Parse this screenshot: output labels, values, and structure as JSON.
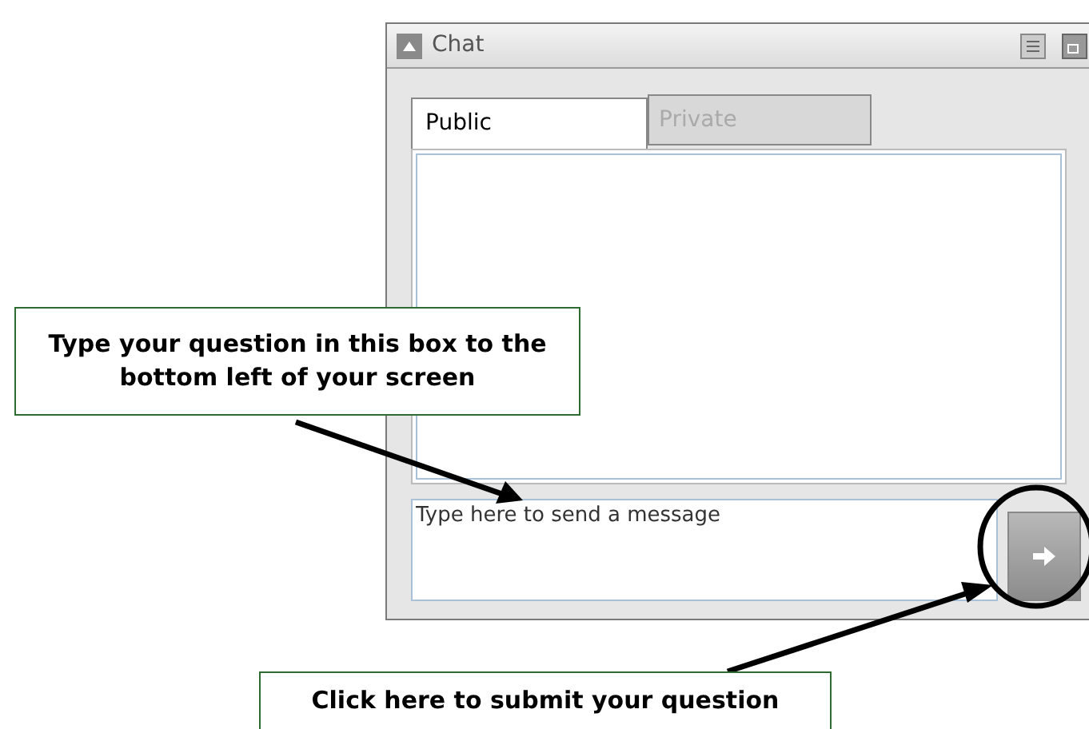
{
  "window": {
    "title": "Chat"
  },
  "tabs": [
    {
      "label": "Public",
      "selected": true
    },
    {
      "label": "Private",
      "selected": false
    }
  ],
  "message_input": {
    "placeholder": "Type here to send a message"
  },
  "callouts": [
    {
      "text": "Type your question in this box to the bottom left of your screen"
    },
    {
      "text": "Click here to submit your question"
    }
  ]
}
